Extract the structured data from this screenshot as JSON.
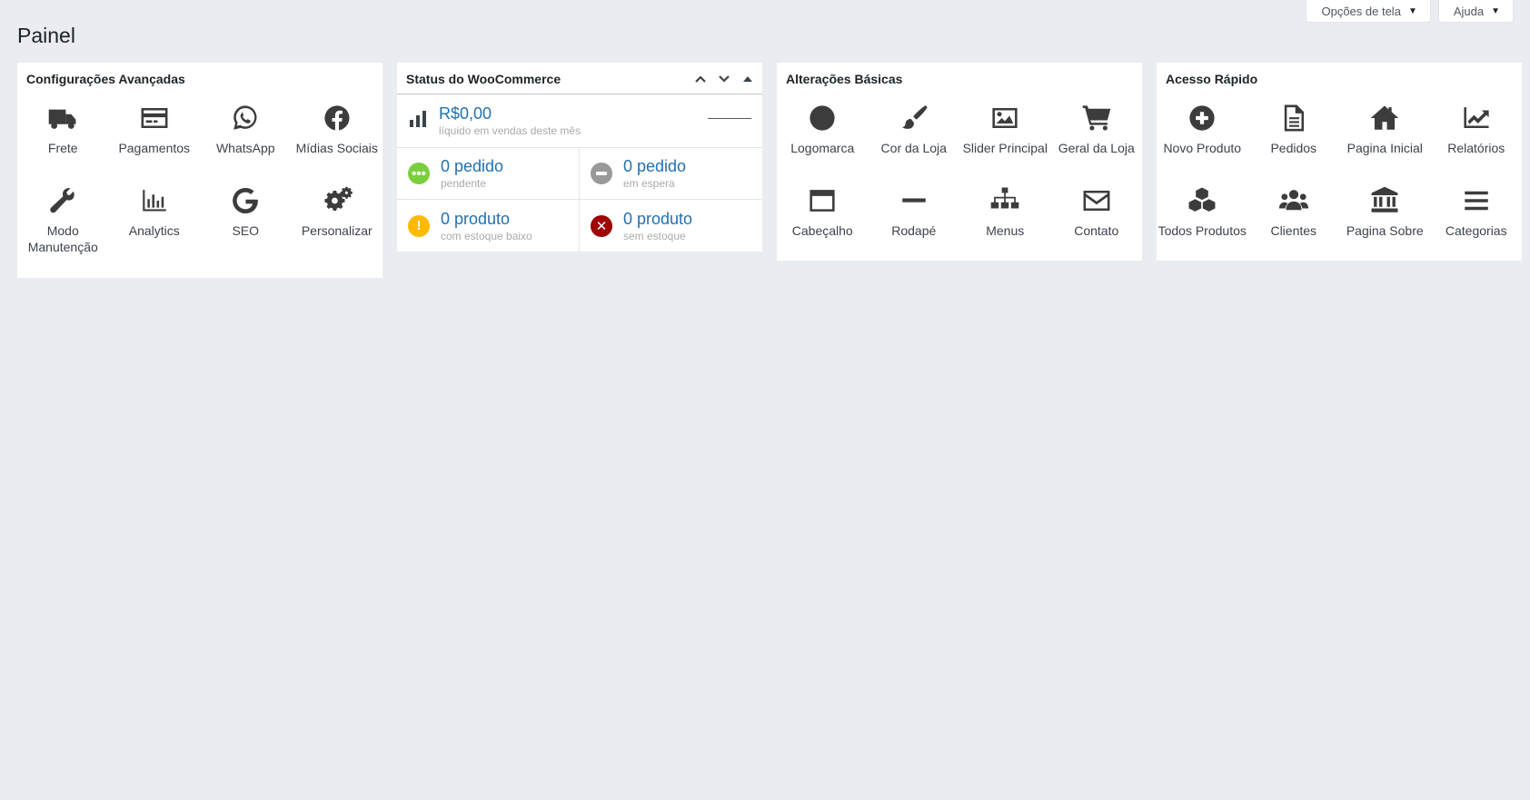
{
  "header": {
    "screen_options": "Opções de tela",
    "help": "Ajuda",
    "page_title": "Painel"
  },
  "advanced": {
    "title": "Configurações Avançadas",
    "items": [
      {
        "label": "Frete",
        "icon": "truck-icon"
      },
      {
        "label": "Pagamentos",
        "icon": "credit-card-icon"
      },
      {
        "label": "WhatsApp",
        "icon": "whatsapp-icon"
      },
      {
        "label": "Mídias Sociais",
        "icon": "facebook-icon"
      },
      {
        "label": "Modo Manutenção",
        "icon": "wrench-icon"
      },
      {
        "label": "Analytics",
        "icon": "bar-chart-icon"
      },
      {
        "label": "SEO",
        "icon": "google-icon"
      },
      {
        "label": "Personalizar",
        "icon": "gears-icon"
      }
    ]
  },
  "woo": {
    "title": "Status do WooCommerce",
    "sales_value": "R$0,00",
    "sales_caption": "líquido em vendas deste mês",
    "cells": [
      {
        "value": "0 pedido",
        "caption": "pendente",
        "color": "#7ad03a",
        "icon": "processing-icon"
      },
      {
        "value": "0 pedido",
        "caption": "em espera",
        "color": "#999999",
        "icon": "on-hold-icon"
      },
      {
        "value": "0 produto",
        "caption": "com estoque baixo",
        "color": "#ffba00",
        "icon": "warning-icon"
      },
      {
        "value": "0 produto",
        "caption": "sem estoque",
        "color": "#a00000",
        "icon": "out-of-stock-icon"
      }
    ]
  },
  "basic": {
    "title": "Alterações Básicas",
    "items": [
      {
        "label": "Logomarca",
        "icon": "circle-icon"
      },
      {
        "label": "Cor da Loja",
        "icon": "paintbrush-icon"
      },
      {
        "label": "Slider Principal",
        "icon": "image-icon"
      },
      {
        "label": "Geral da Loja",
        "icon": "cart-icon"
      },
      {
        "label": "Cabeçalho",
        "icon": "window-icon"
      },
      {
        "label": "Rodapé",
        "icon": "minus-icon"
      },
      {
        "label": "Menus",
        "icon": "sitemap-icon"
      },
      {
        "label": "Contato",
        "icon": "envelope-icon"
      }
    ]
  },
  "quick": {
    "title": "Acesso Rápido",
    "items": [
      {
        "label": "Novo Produto",
        "icon": "plus-circle-icon"
      },
      {
        "label": "Pedidos",
        "icon": "file-icon"
      },
      {
        "label": "Pagina Inicial",
        "icon": "home-icon"
      },
      {
        "label": "Relatórios",
        "icon": "line-chart-icon"
      },
      {
        "label": "Todos Produtos",
        "icon": "cubes-icon"
      },
      {
        "label": "Clientes",
        "icon": "users-icon"
      },
      {
        "label": "Pagina Sobre",
        "icon": "bank-icon"
      },
      {
        "label": "Categorias",
        "icon": "menu-icon"
      }
    ]
  }
}
